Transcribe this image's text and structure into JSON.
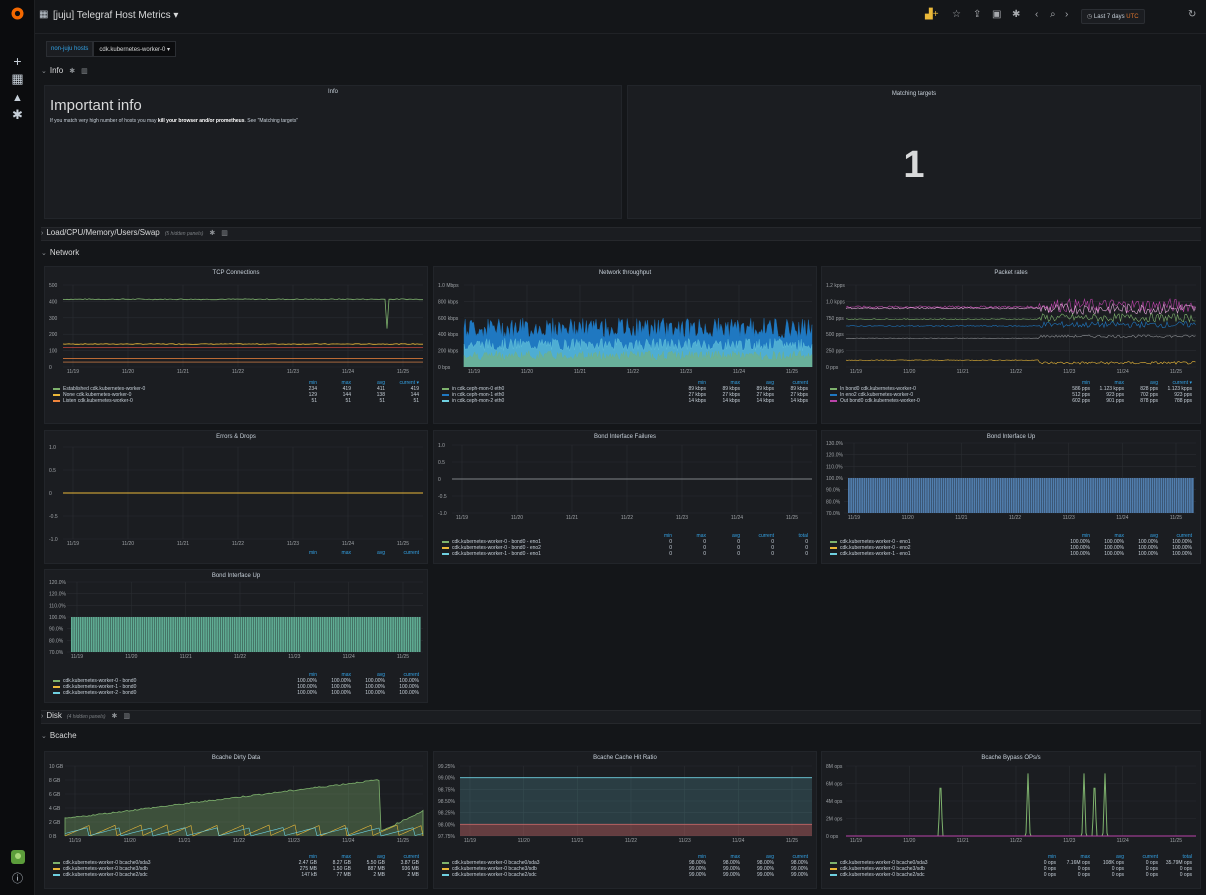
{
  "topbar": {
    "title": "[juju] Telegraf Host Metrics",
    "time_prefix": "Last 7 days",
    "time_tz": "UTC"
  },
  "variables": {
    "label": "non-juju hosts",
    "value": "cdk.kubernetes-worker-0 ▾"
  },
  "rows": {
    "info": "Info",
    "load": "Load/CPU/Memory/Users/Swap",
    "load_hidden": "(5 hidden panels)",
    "network": "Network",
    "disk": "Disk",
    "disk_hidden": "(4 hidden panels)",
    "bcache": "Bcache"
  },
  "info_panel": {
    "title": "Info",
    "heading": "Important info",
    "text_pre": "If you match very high number of hosts you may ",
    "text_bold": "kill your browser and/or prometheus",
    "text_post": ". See \"Matching targets\""
  },
  "matching_panel": {
    "title": "Matching targets",
    "value": "1"
  },
  "x_ticks": [
    "11/19",
    "11/20",
    "11/21",
    "11/22",
    "11/23",
    "11/24",
    "11/25"
  ],
  "legend_headers": {
    "min": "min",
    "max": "max",
    "avg": "avg",
    "current": "current",
    "current_sorted": "current ▾",
    "total": "total"
  },
  "panels": {
    "tcp": {
      "title": "TCP Connections",
      "y_ticks": [
        "500",
        "400",
        "300",
        "200",
        "100",
        "0"
      ],
      "legend": [
        {
          "name": "Established cdk.kubernetes-worker-0",
          "color": "#7eb26d",
          "min": "234",
          "max": "419",
          "avg": "411",
          "current": "419"
        },
        {
          "name": "None cdk.kubernetes-worker-0",
          "color": "#eab839",
          "min": "129",
          "max": "144",
          "avg": "138",
          "current": "144"
        },
        {
          "name": "Listen cdk.kubernetes-worker-0",
          "color": "#ef843c",
          "min": "51",
          "max": "51",
          "avg": "51",
          "current": "51"
        }
      ]
    },
    "throughput": {
      "title": "Network throughput",
      "y_ticks": [
        "1.0 Mbps",
        "800 kbps",
        "600 kbps",
        "400 kbps",
        "200 kbps",
        "0 bps"
      ],
      "legend": [
        {
          "name": "in cdk.ceph-mon-0 eth0",
          "color": "#7eb26d",
          "min": "89 kbps",
          "max": "89 kbps",
          "avg": "89 kbps",
          "current": "89 kbps"
        },
        {
          "name": "in cdk.ceph-mon-1 eth0",
          "color": "#1f78c1",
          "min": "27 kbps",
          "max": "27 kbps",
          "avg": "27 kbps",
          "current": "27 kbps"
        },
        {
          "name": "in cdk.ceph-mon-2 eth0",
          "color": "#6ed0e0",
          "min": "14 kbps",
          "max": "14 kbps",
          "avg": "14 kbps",
          "current": "14 kbps"
        }
      ]
    },
    "packets": {
      "title": "Packet rates",
      "y_ticks": [
        "1.2 kpps",
        "1.0 kpps",
        "750 pps",
        "500 pps",
        "250 pps",
        "0 pps"
      ],
      "legend": [
        {
          "name": "In bond0 cdk.kubernetes-worker-0",
          "color": "#7eb26d",
          "min": "586 pps",
          "max": "1.123 kpps",
          "avg": "828 pps",
          "current": "1.123 kpps"
        },
        {
          "name": "In eno2 cdk.kubernetes-worker-0",
          "color": "#1f78c1",
          "min": "512 pps",
          "max": "923 pps",
          "avg": "702 pps",
          "current": "923 pps"
        },
        {
          "name": "Out bond0 cdk.kubernetes-worker-0",
          "color": "#ba43a9",
          "min": "602 pps",
          "max": "901 pps",
          "avg": "878 pps",
          "current": "788 pps"
        }
      ]
    },
    "errors": {
      "title": "Errors & Drops",
      "y_ticks": [
        "1.0",
        "0.5",
        "0",
        "-0.5",
        "-1.0"
      ]
    },
    "bond_fail": {
      "title": "Bond Interface Failures",
      "y_ticks": [
        "1.0",
        "0.5",
        "0",
        "-0.5",
        "-1.0"
      ],
      "legend": [
        {
          "name": "cdk.kubernetes-worker-0 - bond0 - eno1",
          "color": "#7eb26d",
          "min": "0",
          "max": "0",
          "avg": "0",
          "current": "0",
          "total": "0"
        },
        {
          "name": "cdk.kubernetes-worker-0 - bond0 - eno2",
          "color": "#eab839",
          "min": "0",
          "max": "0",
          "avg": "0",
          "current": "0",
          "total": "0"
        },
        {
          "name": "cdk.kubernetes-worker-1 - bond0 - eno1",
          "color": "#6ed0e0",
          "min": "0",
          "max": "0",
          "avg": "0",
          "current": "0",
          "total": "0"
        }
      ]
    },
    "bond_up": {
      "title": "Bond Interface Up",
      "y_ticks": [
        "130.0%",
        "120.0%",
        "110.0%",
        "100.0%",
        "90.0%",
        "80.0%",
        "70.0%"
      ],
      "legend": [
        {
          "name": "cdk.kubernetes-worker-0 - eno1",
          "color": "#7eb26d",
          "min": "100.00%",
          "max": "100.00%",
          "avg": "100.00%",
          "current": "100.00%"
        },
        {
          "name": "cdk.kubernetes-worker-0 - eno2",
          "color": "#eab839",
          "min": "100.00%",
          "max": "100.00%",
          "avg": "100.00%",
          "current": "100.00%"
        },
        {
          "name": "cdk.kubernetes-worker-1 - eno1",
          "color": "#6ed0e0",
          "min": "100.00%",
          "max": "100.00%",
          "avg": "100.00%",
          "current": "100.00%"
        }
      ]
    },
    "bond_up2": {
      "title": "Bond Interface Up",
      "y_ticks": [
        "120.0%",
        "120.0%",
        "110.0%",
        "100.0%",
        "90.0%",
        "80.0%",
        "70.0%"
      ],
      "legend": [
        {
          "name": "cdk.kubernetes-worker-0 - bond0",
          "color": "#7eb26d",
          "min": "100.00%",
          "max": "100.00%",
          "avg": "100.00%",
          "current": "100.00%"
        },
        {
          "name": "cdk.kubernetes-worker-1 - bond0",
          "color": "#eab839",
          "min": "100.00%",
          "max": "100.00%",
          "avg": "100.00%",
          "current": "100.00%"
        },
        {
          "name": "cdk.kubernetes-worker-2 - bond0",
          "color": "#6ed0e0",
          "min": "100.00%",
          "max": "100.00%",
          "avg": "100.00%",
          "current": "100.00%"
        }
      ]
    },
    "bc_dirty": {
      "title": "Bcache Dirty Data",
      "y_ticks": [
        "10 GB",
        "8 GB",
        "6 GB",
        "4 GB",
        "2 GB",
        "0 B"
      ],
      "legend": [
        {
          "name": "cdk.kubernetes-worker-0 bcache0/sda3",
          "color": "#7eb26d",
          "min": "2.47 GB",
          "max": "8.27 GB",
          "avg": "5.50 GB",
          "current": "3.87 GB"
        },
        {
          "name": "cdk.kubernetes-worker-0 bcache3/sdb",
          "color": "#eab839",
          "min": "275 MB",
          "max": "1.50 GB",
          "avg": "887 MB",
          "current": "936 MB"
        },
        {
          "name": "cdk.kubernetes-worker-0 bcache2/sdc",
          "color": "#6ed0e0",
          "min": "147 kB",
          "max": "77 MB",
          "avg": "2 MB",
          "current": "2 MB"
        }
      ]
    },
    "bc_hit": {
      "title": "Bcache Cache Hit Ratio",
      "y_ticks": [
        "99.25%",
        "99.00%",
        "98.75%",
        "98.50%",
        "98.25%",
        "98.00%",
        "97.75%"
      ],
      "legend": [
        {
          "name": "cdk.kubernetes-worker-0 bcache0/sda3",
          "color": "#7eb26d",
          "min": "98.00%",
          "max": "98.00%",
          "avg": "98.00%",
          "current": "98.00%"
        },
        {
          "name": "cdk.kubernetes-worker-0 bcache3/sdb",
          "color": "#eab839",
          "min": "99.00%",
          "max": "99.00%",
          "avg": "99.00%",
          "current": "99.00%"
        },
        {
          "name": "cdk.kubernetes-worker-0 bcache2/sdc",
          "color": "#6ed0e0",
          "min": "99.00%",
          "max": "99.00%",
          "avg": "99.00%",
          "current": "99.00%"
        }
      ]
    },
    "bc_bypass": {
      "title": "Bcache Bypass OPs/s",
      "y_ticks": [
        "8M ops",
        "6M ops",
        "4M ops",
        "2M ops",
        "0 ops"
      ],
      "legend": [
        {
          "name": "cdk.kubernetes-worker-0 bcache0/sda3",
          "color": "#7eb26d",
          "min": "0 ops",
          "max": "7.16M ops",
          "avg": "108K ops",
          "current": "0 ops",
          "total": "35.79M ops"
        },
        {
          "name": "cdk.kubernetes-worker-0 bcache3/sdb",
          "color": "#eab839",
          "min": "0 ops",
          "max": "0 ops",
          "avg": "0 ops",
          "current": "0 ops",
          "total": "0 ops"
        },
        {
          "name": "cdk.kubernetes-worker-0 bcache2/sdc",
          "color": "#6ed0e0",
          "min": "0 ops",
          "max": "0 ops",
          "avg": "0 ops",
          "current": "0 ops",
          "total": "0 ops"
        }
      ]
    }
  },
  "colors": {
    "green": "#7eb26d",
    "yellow": "#eab839",
    "blue": "#1f78c1",
    "cyan": "#6ed0e0",
    "purple": "#ba43a9",
    "orange": "#ef843c",
    "accent": "#33a2e5"
  }
}
